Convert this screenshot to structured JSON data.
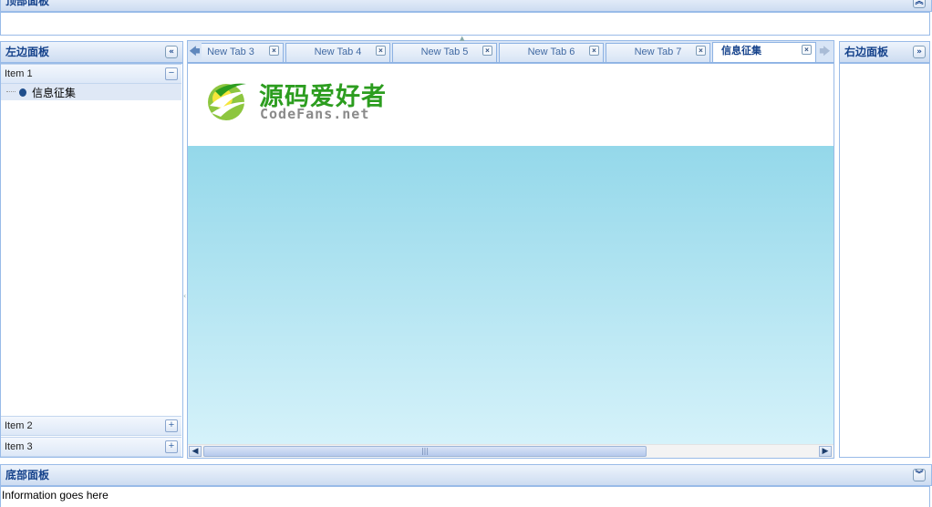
{
  "top_panel": {
    "title": "顶部面板",
    "collapse_icon": "chevron-up-double"
  },
  "left_panel": {
    "title": "左边面板",
    "collapse_icon": "chevron-left-double",
    "accordion": [
      {
        "label": "Item 1",
        "expanded": true,
        "toggle": "−",
        "tree": [
          {
            "label": "信息征集"
          }
        ]
      },
      {
        "label": "Item 2",
        "expanded": false,
        "toggle": "+"
      },
      {
        "label": "Item 3",
        "expanded": false,
        "toggle": "+"
      }
    ]
  },
  "center_panel": {
    "tabs": [
      {
        "label": "New Tab 3",
        "active": false
      },
      {
        "label": "New Tab 4",
        "active": false
      },
      {
        "label": "New Tab 5",
        "active": false
      },
      {
        "label": "New Tab 6",
        "active": false
      },
      {
        "label": "New Tab 7",
        "active": false
      },
      {
        "label": "信息征集",
        "active": true
      }
    ],
    "close_glyph": "×",
    "logo": {
      "cn": "源码爱好者",
      "en": "CodeFans.net"
    },
    "colors": {
      "gradient_top": "#94d8ea",
      "gradient_bottom": "#d5f2fa",
      "logo_green": "#2c9d1f"
    }
  },
  "right_panel": {
    "title": "右边面板",
    "collapse_icon": "chevron-right-double"
  },
  "bottom_panel": {
    "title": "底部面板",
    "collapse_icon": "chevron-down-double",
    "body_text": "Information goes here"
  },
  "theme": {
    "header_text": "#15428b",
    "border": "#99bbe8"
  }
}
